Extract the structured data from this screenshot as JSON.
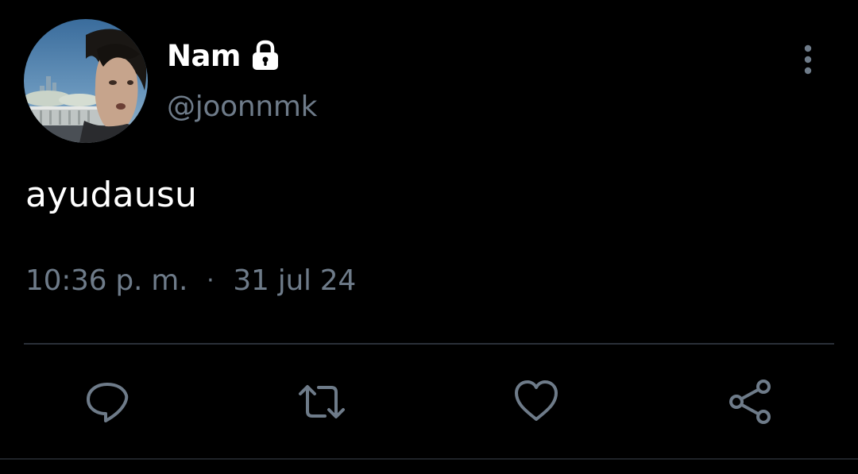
{
  "user": {
    "display_name": "Nam",
    "handle": "@joonnmk",
    "locked_icon": "lock-icon",
    "avatar_icon": "avatar"
  },
  "tweet": {
    "text": "ayudausu",
    "time": "10:36 p. m.",
    "separator": "·",
    "date": "31 jul 24"
  },
  "actions": {
    "reply_icon": "comment-icon",
    "retweet_icon": "retweet-icon",
    "like_icon": "heart-icon",
    "share_icon": "share-icon",
    "more_icon": "more-vertical-icon"
  },
  "colors": {
    "background": "#000000",
    "text_primary": "#ffffff",
    "text_secondary": "#6e7b89",
    "divider": "#2a3038"
  }
}
